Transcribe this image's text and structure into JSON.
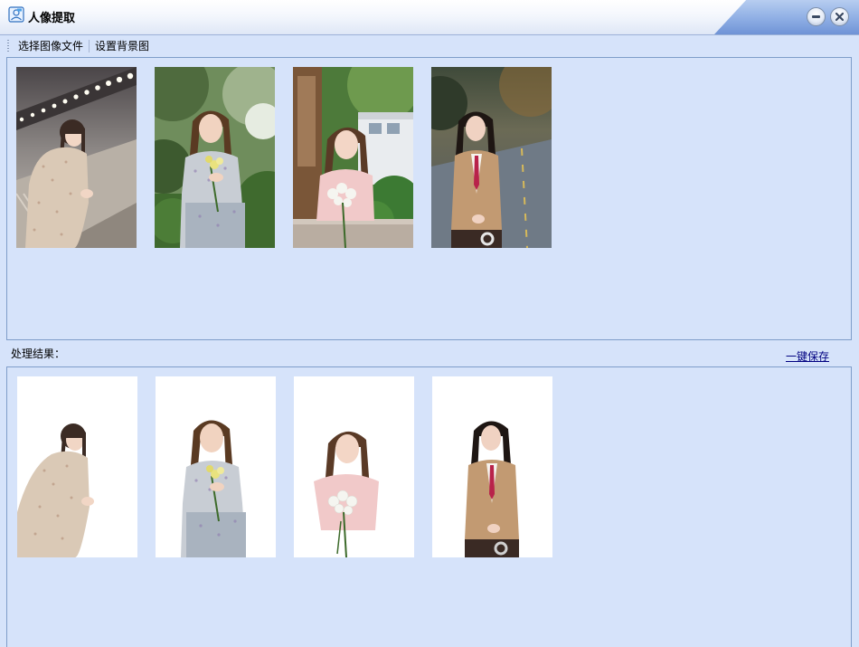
{
  "window": {
    "title": "人像提取",
    "app_icon": "portrait-app-icon",
    "minimize_icon": "minimize-icon",
    "close_icon": "close-icon"
  },
  "toolbar": {
    "select_image_label": "选择图像文件",
    "set_background_label": "设置背景图"
  },
  "source_images": [
    {
      "name": "photo-1",
      "desc": "woman in floral dress leaning on railing",
      "background": "bridge"
    },
    {
      "name": "photo-2",
      "desc": "woman in floral dress holding flowers",
      "background": "garden"
    },
    {
      "name": "photo-3",
      "desc": "woman in pink top holding white roses",
      "background": "house"
    },
    {
      "name": "photo-4",
      "desc": "woman in tan blazer with striped tie",
      "background": "road"
    }
  ],
  "results": {
    "label": "处理结果：",
    "save_all_label": "一键保存",
    "items": [
      {
        "name": "result-1",
        "background": "white"
      },
      {
        "name": "result-2",
        "background": "white"
      },
      {
        "name": "result-3",
        "background": "white"
      },
      {
        "name": "result-4",
        "background": "white"
      }
    ]
  },
  "colors": {
    "window_bg": "#d6e3fa",
    "panel_border": "#7f9dc9",
    "link": "#000080"
  }
}
